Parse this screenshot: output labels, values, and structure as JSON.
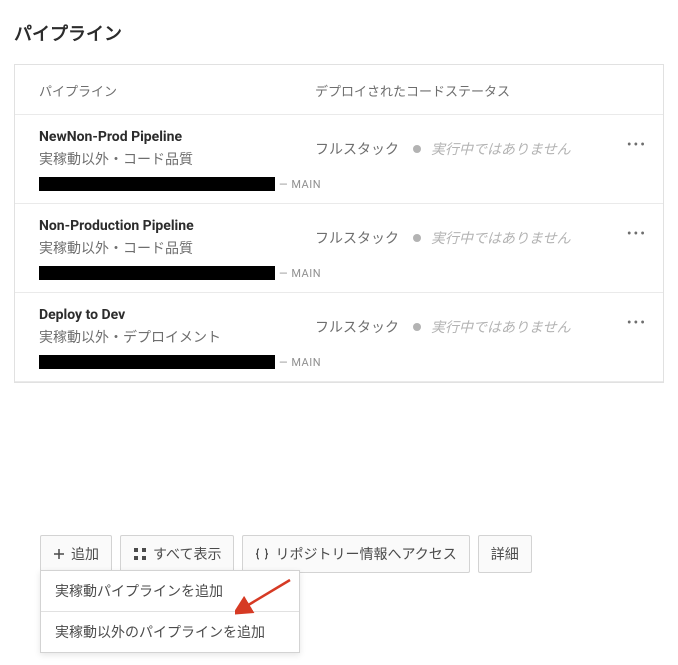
{
  "page_title": "パイプライン",
  "table": {
    "header_pipeline": "パイプライン",
    "header_status": "デプロイされたコードステータス"
  },
  "pipelines": [
    {
      "name": "NewNon-Prod Pipeline",
      "subtitle": "実稼動以外・コード品質",
      "deploy_type": "フルスタック",
      "status_text": "実行中ではありません",
      "branch": "MAIN"
    },
    {
      "name": "Non-Production Pipeline",
      "subtitle": "実稼動以外・コード品質",
      "deploy_type": "フルスタック",
      "status_text": "実行中ではありません",
      "branch": "MAIN"
    },
    {
      "name": "Deploy to Dev",
      "subtitle": "実稼動以外・デプロイメント",
      "deploy_type": "フルスタック",
      "status_text": "実行中ではありません",
      "branch": "MAIN"
    }
  ],
  "buttons": {
    "add": "追加",
    "show_all": "すべて表示",
    "repo_info": "リポジトリー情報へアクセス",
    "details": "詳細"
  },
  "dropdown": {
    "add_production": "実稼動パイプラインを追加",
    "add_nonproduction": "実稼動以外のパイプラインを追加"
  },
  "colors": {
    "border": "#e1e1e1",
    "text_primary": "#2c2c2c",
    "text_secondary": "#6e6e6e",
    "text_muted": "#b3b3b3",
    "arrow": "#d63a24"
  }
}
